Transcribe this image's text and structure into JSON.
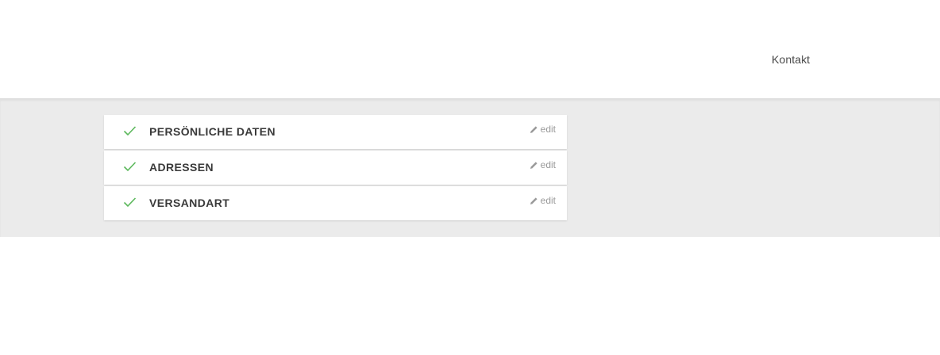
{
  "header": {
    "contact_link": "Kontakt"
  },
  "colors": {
    "check": "#5cb85c",
    "edit": "#9a9a9a",
    "band": "#ebebeb"
  },
  "steps": [
    {
      "title": "PERSÖNLICHE DATEN",
      "edit_label": "edit",
      "status_icon": "check-icon",
      "edit_icon": "pencil-icon"
    },
    {
      "title": "ADRESSEN",
      "edit_label": "edit",
      "status_icon": "check-icon",
      "edit_icon": "pencil-icon"
    },
    {
      "title": "VERSANDART",
      "edit_label": "edit",
      "status_icon": "check-icon",
      "edit_icon": "pencil-icon"
    }
  ]
}
